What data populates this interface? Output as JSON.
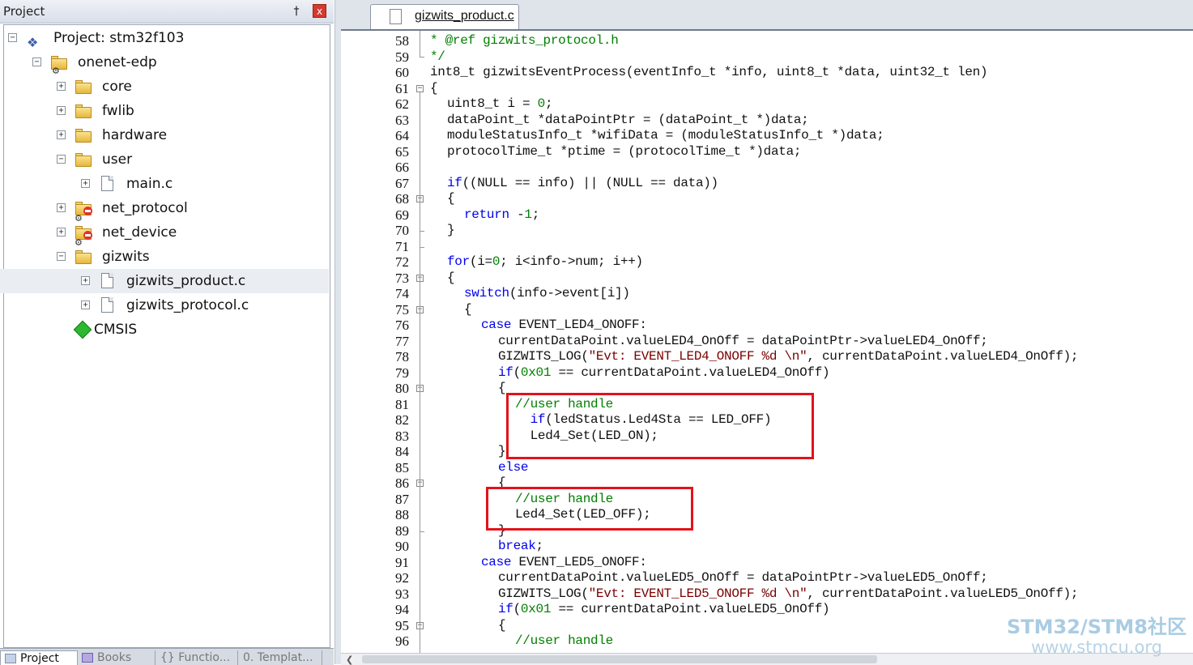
{
  "project_panel": {
    "title": "Project",
    "pin_glyph": "†",
    "close_glyph": "x",
    "tree": [
      {
        "label": "Project: stm32f103",
        "icon": "project-icon",
        "expanded": true
      },
      {
        "label": "onenet-edp",
        "icon": "target-icon",
        "expanded": true
      },
      {
        "label": "core",
        "icon": "folder-icon",
        "expanded": false
      },
      {
        "label": "fwlib",
        "icon": "folder-icon",
        "expanded": false
      },
      {
        "label": "hardware",
        "icon": "folder-icon",
        "expanded": false
      },
      {
        "label": "user",
        "icon": "folder-open-icon",
        "expanded": true
      },
      {
        "label": "main.c",
        "icon": "file-icon",
        "expanded": false
      },
      {
        "label": "net_protocol",
        "icon": "excluded-group-icon",
        "expanded": false
      },
      {
        "label": "net_device",
        "icon": "excluded-group-icon",
        "expanded": false
      },
      {
        "label": "gizwits",
        "icon": "folder-open-icon",
        "expanded": true
      },
      {
        "label": "gizwits_product.c",
        "icon": "file-icon",
        "expanded": false,
        "selected": true
      },
      {
        "label": "gizwits_protocol.c",
        "icon": "file-icon",
        "expanded": false
      },
      {
        "label": "CMSIS",
        "icon": "diamond-icon",
        "expanded": false
      }
    ],
    "bottom_tabs": [
      "Project",
      "Books",
      "{} Functio...",
      "0. Templat..."
    ]
  },
  "editor": {
    "tab_label": "gizwits_product.c",
    "lines": [
      {
        "n": "58",
        "html": "<span class=\"cm\">* @ref gizwits_protocol.h</span>",
        "indent": 0
      },
      {
        "n": "59",
        "html": "<span class=\"cm\">*/</span>",
        "indent": 0
      },
      {
        "n": "60",
        "html": "int8_t gizwitsEventProcess(eventInfo_t *info, uint8_t *data, uint32_t len)",
        "indent": 0
      },
      {
        "n": "61",
        "html": "{",
        "indent": 0
      },
      {
        "n": "62",
        "html": "uint8_t i = <span class=\"num\">0</span>;",
        "indent": 1
      },
      {
        "n": "63",
        "html": "dataPoint_t *dataPointPtr = (dataPoint_t *)data;",
        "indent": 1
      },
      {
        "n": "64",
        "html": "moduleStatusInfo_t *wifiData = (moduleStatusInfo_t *)data;",
        "indent": 1
      },
      {
        "n": "65",
        "html": "protocolTime_t *ptime = (protocolTime_t *)data;",
        "indent": 1
      },
      {
        "n": "66",
        "html": "",
        "indent": 1
      },
      {
        "n": "67",
        "html": "<span class=\"kw\">if</span>((NULL == info) || (NULL == data))",
        "indent": 1
      },
      {
        "n": "68",
        "html": "{",
        "indent": 1
      },
      {
        "n": "69",
        "html": "<span class=\"kw\">return</span> -<span class=\"num\">1</span>;",
        "indent": 2
      },
      {
        "n": "70",
        "html": "}",
        "indent": 1
      },
      {
        "n": "71",
        "html": "",
        "indent": 1
      },
      {
        "n": "72",
        "html": "<span class=\"kw\">for</span>(i=<span class=\"num\">0</span>; i&lt;info-&gt;num; i++)",
        "indent": 1
      },
      {
        "n": "73",
        "html": "{",
        "indent": 1
      },
      {
        "n": "74",
        "html": "<span class=\"kw\">switch</span>(info-&gt;event[i])",
        "indent": 2
      },
      {
        "n": "75",
        "html": "{",
        "indent": 2
      },
      {
        "n": "76",
        "html": "<span class=\"kw\">case</span> EVENT_LED4_ONOFF:",
        "indent": 3
      },
      {
        "n": "77",
        "html": "currentDataPoint.valueLED4_OnOff = dataPointPtr-&gt;valueLED4_OnOff;",
        "indent": 4
      },
      {
        "n": "78",
        "html": "GIZWITS_LOG(<span class=\"str\">\"Evt: EVENT_LED4_ONOFF %d \\n\"</span>, currentDataPoint.valueLED4_OnOff);",
        "indent": 4
      },
      {
        "n": "79",
        "html": "<span class=\"kw\">if</span>(<span class=\"num\">0x01</span> == currentDataPoint.valueLED4_OnOff)",
        "indent": 4
      },
      {
        "n": "80",
        "html": "{",
        "indent": 4
      },
      {
        "n": "81",
        "html": "<span class=\"cm\">//user handle</span>",
        "indent": 5
      },
      {
        "n": "82",
        "html": "  <span class=\"kw\">if</span>(ledStatus.Led4Sta == LED_OFF)",
        "indent": 5
      },
      {
        "n": "83",
        "html": "  Led4_Set(LED_ON);",
        "indent": 5
      },
      {
        "n": "84",
        "html": "}",
        "indent": 4
      },
      {
        "n": "85",
        "html": "<span class=\"kw\">else</span>",
        "indent": 4
      },
      {
        "n": "86",
        "html": "{",
        "indent": 4
      },
      {
        "n": "87",
        "html": "<span class=\"cm\">//user handle</span>",
        "indent": 5
      },
      {
        "n": "88",
        "html": "Led4_Set(LED_OFF);",
        "indent": 5
      },
      {
        "n": "89",
        "html": "}",
        "indent": 4
      },
      {
        "n": "90",
        "html": "<span class=\"kw\">break</span>;",
        "indent": 4
      },
      {
        "n": "91",
        "html": "<span class=\"kw\">case</span> EVENT_LED5_ONOFF:",
        "indent": 3
      },
      {
        "n": "92",
        "html": "currentDataPoint.valueLED5_OnOff = dataPointPtr-&gt;valueLED5_OnOff;",
        "indent": 4
      },
      {
        "n": "93",
        "html": "GIZWITS_LOG(<span class=\"str\">\"Evt: EVENT_LED5_ONOFF %d \\n\"</span>, currentDataPoint.valueLED5_OnOff);",
        "indent": 4
      },
      {
        "n": "94",
        "html": "<span class=\"kw\">if</span>(<span class=\"num\">0x01</span> == currentDataPoint.valueLED5_OnOff)",
        "indent": 4
      },
      {
        "n": "95",
        "html": "{",
        "indent": 4
      },
      {
        "n": "96",
        "html": "<span class=\"cm\">//user handle</span>",
        "indent": 5
      }
    ]
  },
  "watermark": {
    "title": "STM32/STM8社区",
    "url": "www.stmcu.org"
  }
}
